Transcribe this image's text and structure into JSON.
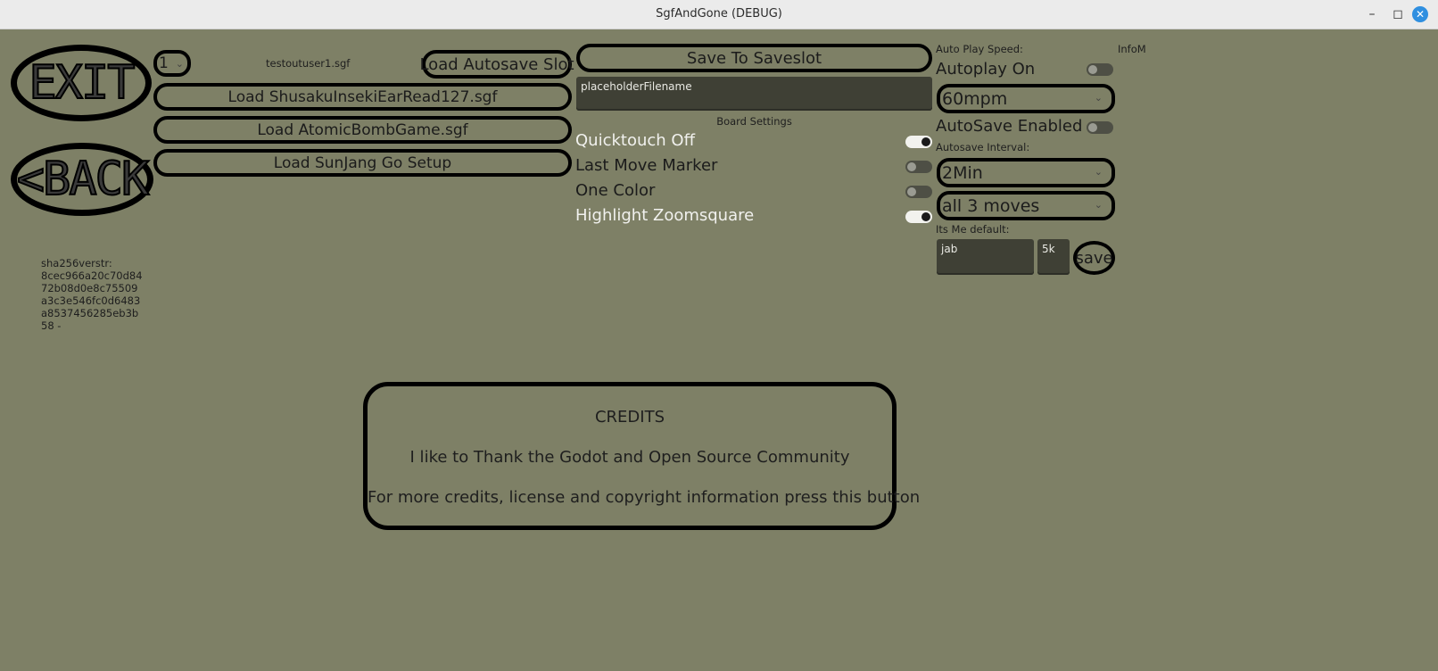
{
  "window": {
    "title": "SgfAndGone (DEBUG)"
  },
  "nav": {
    "exit_label": "EXIT",
    "back_label": "<BACK"
  },
  "load": {
    "slot_value": "1",
    "filename_label": "testoutuser1.sgf",
    "autosave_slot_button": "Load Autosave Slot",
    "buttons": [
      "Load ShusakuInsekiEarRead127.sgf",
      "Load AtomicBombGame.sgf",
      "Load SunJang Go Setup"
    ]
  },
  "save": {
    "to_slot_button": "Save To Saveslot",
    "filename_placeholder": "placeholderFilename"
  },
  "board_settings": {
    "heading": "Board Settings",
    "options": [
      {
        "label": "Quicktouch Off",
        "on": true
      },
      {
        "label": "Last Move Marker",
        "on": false
      },
      {
        "label": "One Color",
        "on": false
      },
      {
        "label": "Highlight Zoomsquare",
        "on": true
      }
    ]
  },
  "autoplay": {
    "speed_label": "Auto Play Speed:",
    "info_label": "InfoM",
    "toggle_label": "Autoplay On",
    "toggle_on": false,
    "speed_value": "60mpm"
  },
  "autosave": {
    "toggle_label": "AutoSave Enabled",
    "toggle_on": false,
    "interval_label": "Autosave Interval:",
    "interval_value": "2Min",
    "moves_value": "all 3 moves"
  },
  "its_me": {
    "label": "Its Me default:",
    "name_value": "jab",
    "rank_value": "5k",
    "save_button": "save"
  },
  "version": {
    "lines": [
      "sha256verstr:",
      "8cec966a20c70d84",
      "72b08d0e8c75509",
      "a3c3e546fc0d6483",
      "a8537456285eb3b",
      "58  -"
    ]
  },
  "credits": {
    "heading": "CREDITS",
    "thanks": "I like to Thank the Godot and Open Source Community",
    "more": "For more credits, license and copyright information press this button"
  },
  "colors": {
    "background": "#7e8066",
    "border": "#000000",
    "field": "#3f4035"
  }
}
